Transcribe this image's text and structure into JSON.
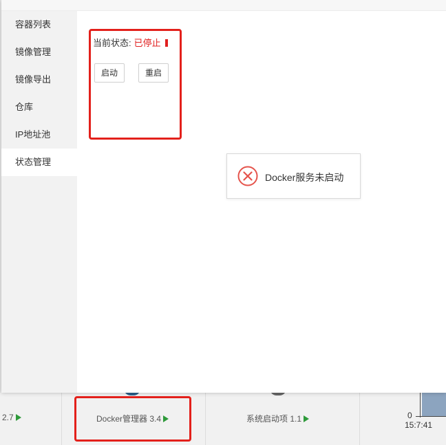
{
  "modal": {
    "sidebar": {
      "items": [
        {
          "label": "容器列表",
          "active": false
        },
        {
          "label": "镜像管理",
          "active": false
        },
        {
          "label": "镜像导出",
          "active": false
        },
        {
          "label": "仓库",
          "active": false
        },
        {
          "label": "IP地址池",
          "active": false
        },
        {
          "label": "状态管理",
          "active": true
        }
      ]
    },
    "status": {
      "label": "当前状态:",
      "value": "已停止",
      "value_color": "#e02020"
    },
    "buttons": {
      "start": "启动",
      "restart": "重启"
    },
    "toast": {
      "icon": "error-circle-x-icon",
      "message": "Docker服务未启动",
      "color": "#e5534b"
    }
  },
  "background": {
    "software_items": [
      {
        "label": "2.7",
        "play_icon": "play-triangle-icon"
      },
      {
        "label": "Docker管理器 3.4",
        "play_icon": "play-triangle-icon"
      },
      {
        "label": "系统启动项 1.1",
        "play_icon": "play-triangle-icon"
      }
    ],
    "chart": {
      "zero_label": "0",
      "time_label": "15:7:41"
    }
  },
  "highlight_color": "#e3201b"
}
